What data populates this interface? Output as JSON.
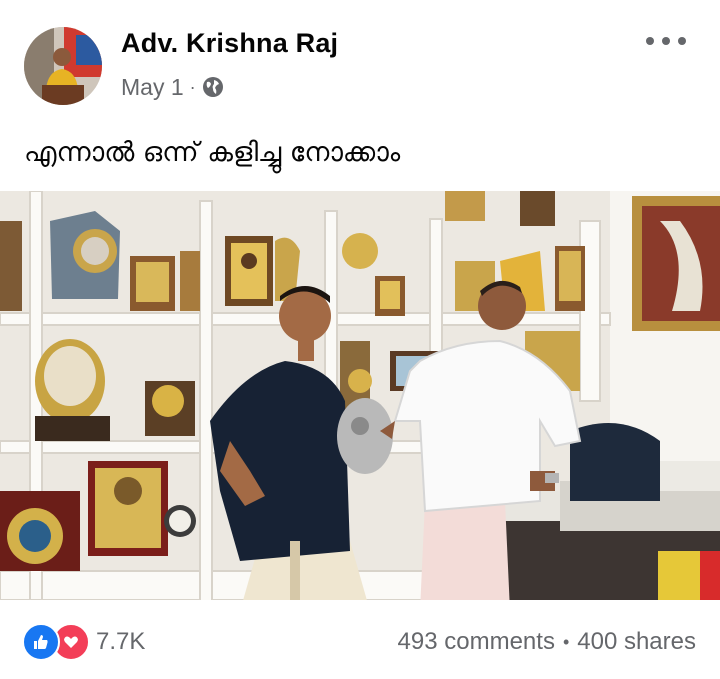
{
  "post": {
    "author": "Adv. Krishna Raj",
    "date": "May 1",
    "separator": "·",
    "privacy_icon": "globe-icon",
    "caption": "എന്നാൽ ഒന്ന് കളിച്ചു നോക്കാം",
    "more_icon": "more-options-icon"
  },
  "footer": {
    "reaction_icons": [
      "like-icon",
      "love-icon"
    ],
    "reaction_count": "7.7K",
    "comments": "493 comments",
    "separator": "•",
    "shares": "400 shares"
  },
  "colors": {
    "text_primary": "#050505",
    "text_secondary": "#65676b",
    "like_blue": "#1877f2",
    "love_red": "#f33e58"
  }
}
